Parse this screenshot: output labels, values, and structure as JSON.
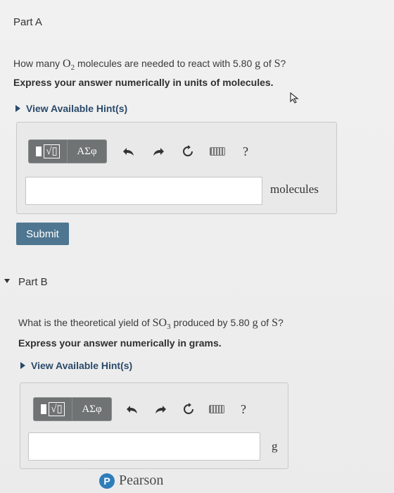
{
  "part_a": {
    "title": "Part A",
    "question_prefix": "How many ",
    "question_chem1": "O",
    "question_chem1_sub": "2",
    "question_mid": " molecules are needed to react with 5.80 ",
    "question_unit": "g",
    "question_of": " of ",
    "question_chem2": "S",
    "question_end": "?",
    "instruction": "Express your answer numerically in units of molecules.",
    "hint_label": "View Available Hint(s)",
    "toolbar": {
      "greek_label": "ΑΣφ",
      "help_label": "?"
    },
    "answer_value": "",
    "unit": "molecules",
    "submit_label": "Submit"
  },
  "part_b": {
    "title": "Part B",
    "question_prefix": "What is the theoretical yield of ",
    "question_chem1": "SO",
    "question_chem1_sub": "3",
    "question_mid": " produced by 5.80 ",
    "question_unit": "g",
    "question_of": " of ",
    "question_chem2": "S",
    "question_end": "?",
    "instruction": "Express your answer numerically in grams.",
    "hint_label": "View Available Hint(s)",
    "toolbar": {
      "greek_label": "ΑΣφ",
      "help_label": "?"
    },
    "answer_value": "",
    "unit": "g"
  },
  "footer": {
    "brand": "Pearson",
    "logo_letter": "P"
  },
  "colors": {
    "submit": "#4e7690",
    "hint": "#2a4a6a",
    "toolbar_btn": "#6f7373",
    "pearson_blue": "#2e7dbb"
  }
}
